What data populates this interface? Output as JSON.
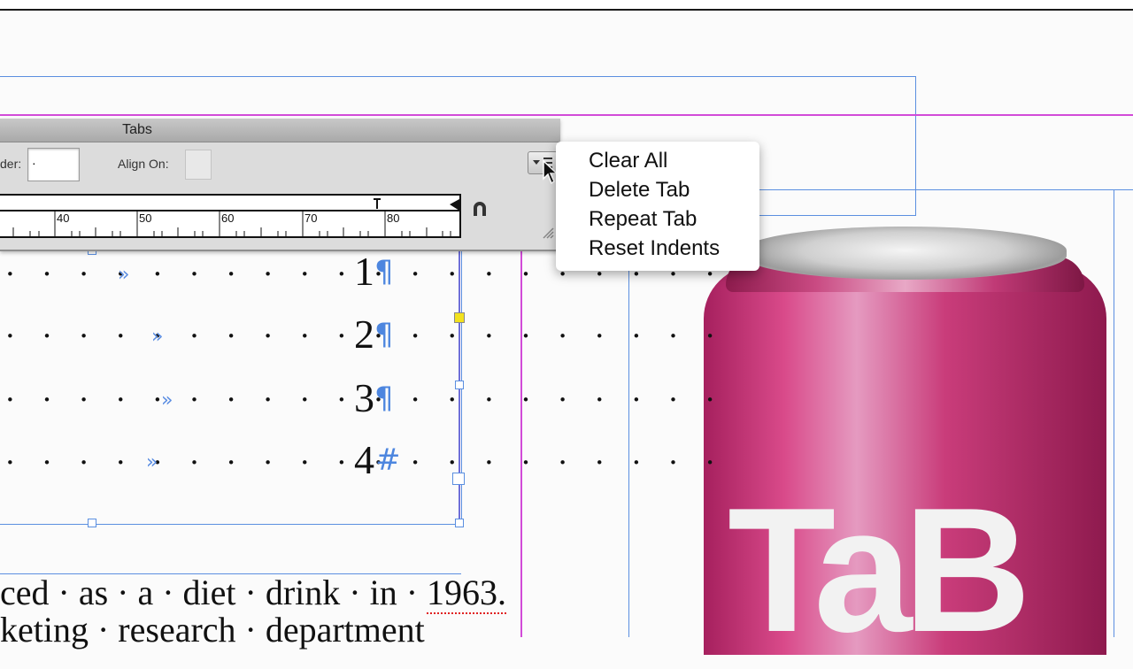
{
  "panel": {
    "title": "Tabs",
    "leader_label": "der:",
    "leader_value": "·",
    "align_on_label": "Align On:",
    "align_on_value": ""
  },
  "ruler": {
    "ticks": [
      "40",
      "50",
      "60",
      "70",
      "80"
    ]
  },
  "flyout_menu": {
    "items": [
      "Clear All",
      "Delete Tab",
      "Repeat Tab",
      "Reset Indents"
    ]
  },
  "text_frame": {
    "lines": [
      {
        "number": "1",
        "end_mark": "¶"
      },
      {
        "number": "2",
        "end_mark": "¶"
      },
      {
        "number": "3",
        "end_mark": "¶"
      },
      {
        "number": "4",
        "end_mark": "#"
      }
    ],
    "tab_marker": "»",
    "leader_dots": "· · · · · · · · · · · · · · · · · · · ·"
  },
  "body_text": {
    "line1_a": "ced · as · a · diet · drink · in · ",
    "line1_b": "1963.",
    "line2": "keting · research · department"
  },
  "image": {
    "can_logo": "TaB"
  },
  "colors": {
    "guide_blue": "#5b8fe0",
    "guide_magenta": "#d24bd8",
    "can_pink": "#c93c7a"
  }
}
